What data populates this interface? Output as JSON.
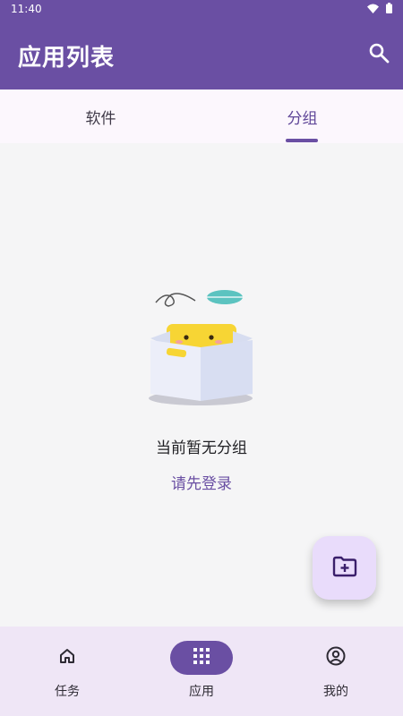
{
  "status_bar": {
    "time": "11:40",
    "icons": [
      "wifi-icon",
      "battery-icon"
    ]
  },
  "header": {
    "title": "应用列表",
    "search_icon": "search-icon"
  },
  "tabs": [
    {
      "label": "软件",
      "selected": false
    },
    {
      "label": "分组",
      "selected": true
    }
  ],
  "empty_state": {
    "message": "当前暂无分组",
    "login_link": "请先登录"
  },
  "fab": {
    "icon": "folder-plus-icon"
  },
  "bottom_nav": [
    {
      "label": "任务",
      "icon": "home-icon",
      "selected": false
    },
    {
      "label": "应用",
      "icon": "apps-grid-icon",
      "selected": true
    },
    {
      "label": "我的",
      "icon": "user-circle-icon",
      "selected": false
    }
  ],
  "colors": {
    "primary": "#6a4fa3",
    "tab_background": "#fcf7fd",
    "bottom_nav_background": "#efe6f6",
    "fab_background": "#e9dcfb"
  }
}
